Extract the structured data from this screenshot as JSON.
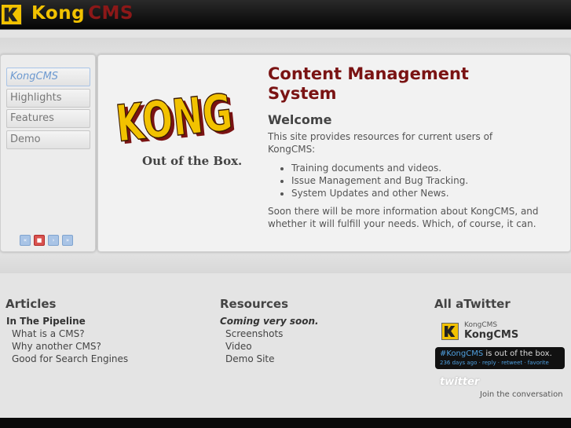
{
  "header": {
    "brand_part1": "Kong",
    "brand_part2": "CMS"
  },
  "nav": {
    "items": [
      {
        "label": "KongCMS",
        "active": true
      },
      {
        "label": "Highlights"
      },
      {
        "label": "Features"
      },
      {
        "label": "Demo"
      }
    ],
    "pager": [
      "«",
      "■",
      "›",
      "»"
    ]
  },
  "main": {
    "logo_text": "KONG",
    "tagline": "Out of the Box.",
    "title": "Content Management System",
    "welcome": "Welcome",
    "intro": "This site provides resources for current users of KongCMS:",
    "bullets": [
      "Training documents and videos.",
      "Issue Management and Bug Tracking.",
      "System Updates and other News."
    ],
    "closing": "Soon there will be more information about KongCMS, and whether it will fulfill your needs. Which, of course, it can."
  },
  "articles": {
    "heading": "Articles",
    "sub": "In The Pipeline",
    "links": [
      "What is a CMS?",
      "Why another CMS?",
      "Good for Search Engines"
    ]
  },
  "resources": {
    "heading": "Resources",
    "sub": "Coming very soon.",
    "links": [
      "Screenshots",
      "Video",
      "Demo Site"
    ]
  },
  "twitter": {
    "heading": "All aTwitter",
    "handle": "KongCMS",
    "name": "KongCMS",
    "tweet_tag": "#KongCMS",
    "tweet_rest": " is out of the box.",
    "tweet_meta": "236 days ago · reply · retweet · favorite",
    "logo": "twitter",
    "join": "Join the conversation"
  },
  "colors": {
    "brand_yellow": "#f2c200",
    "brand_red": "#8c1818",
    "link_blue": "#4fa0e0"
  }
}
